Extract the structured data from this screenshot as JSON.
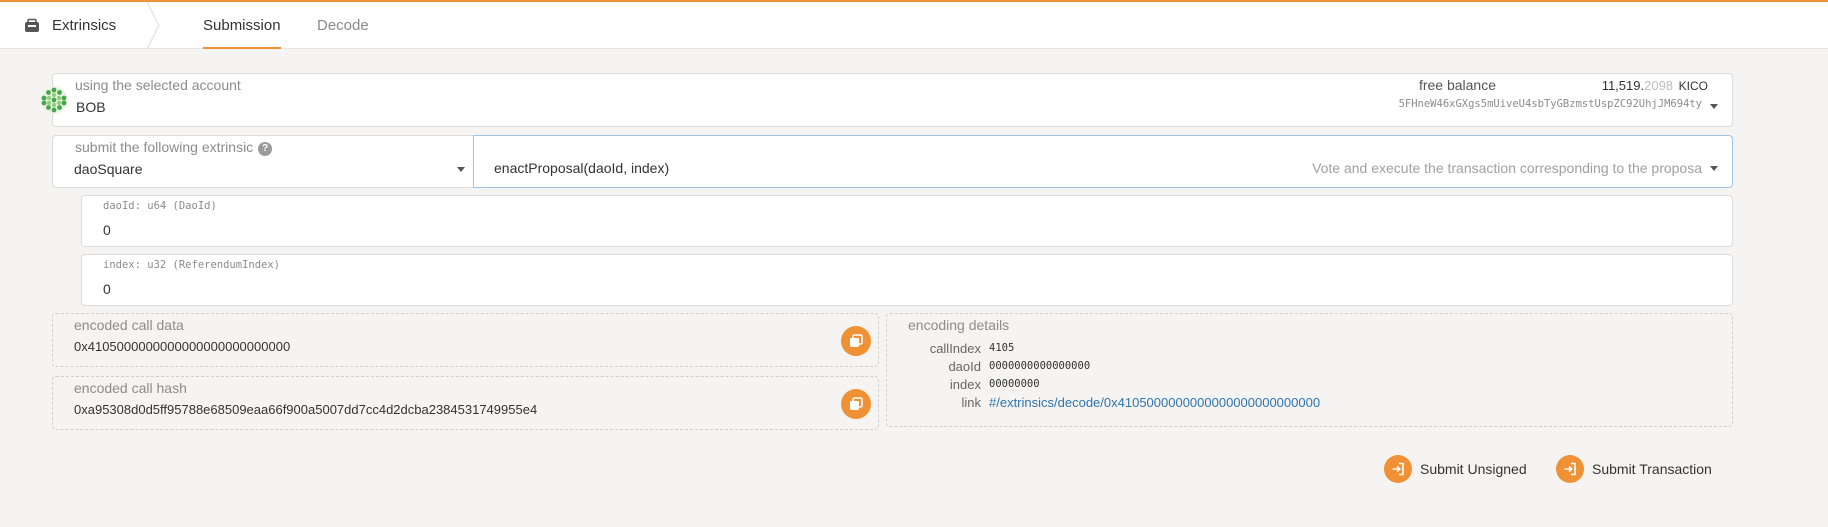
{
  "header": {
    "app_title": "Extrinsics",
    "tabs": [
      {
        "label": "Submission",
        "active": true
      },
      {
        "label": "Decode",
        "active": false
      }
    ]
  },
  "account": {
    "label": "using the selected account",
    "name": "BOB",
    "balance_label": "free balance",
    "balance_int": "11,519.",
    "balance_dec": "2098",
    "balance_unit": "KICO",
    "address": "5FHneW46xGXgs5mUiveU4sbTyGBzmstUspZC92UhjJM694ty"
  },
  "extrinsic": {
    "label": "submit the following extrinsic",
    "module": "daoSquare",
    "method": "enactProposal(daoId, index)",
    "description": "Vote and execute the transaction corresponding to the proposa"
  },
  "params": [
    {
      "label": "daoId: u64 (DaoId)",
      "value": "0"
    },
    {
      "label": "index: u32 (ReferendumIndex)",
      "value": "0"
    }
  ],
  "encoded_call_data": {
    "label": "encoded call data",
    "value": "0x4105000000000000000000000000"
  },
  "encoded_call_hash": {
    "label": "encoded call hash",
    "value": "0xa95308d0d5ff95788e68509eaa66f900a5007dd7cc4d2dcba2384531749955e4"
  },
  "encoding_details": {
    "title": "encoding details",
    "rows": [
      {
        "key": "callIndex",
        "value": "4105"
      },
      {
        "key": "daoId",
        "value": "0000000000000000"
      },
      {
        "key": "index",
        "value": "00000000"
      }
    ],
    "link_key": "link",
    "link_value": "#/extrinsics/decode/0x4105000000000000000000000000"
  },
  "actions": {
    "submit_unsigned": "Submit Unsigned",
    "submit_transaction": "Submit Transaction"
  },
  "colors": {
    "accent": "#f19135",
    "link": "#2f74ae"
  },
  "icons": [
    "extrinsics-icon",
    "help-icon",
    "copy-icon",
    "sign-in-icon",
    "identicon",
    "chevron-down-icon"
  ]
}
